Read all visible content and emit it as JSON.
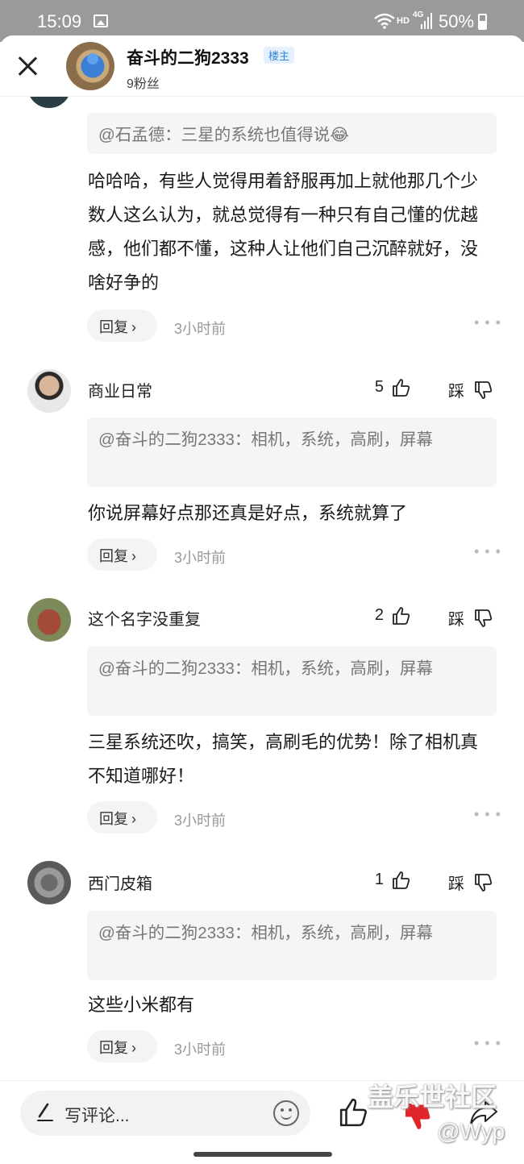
{
  "status_bar": {
    "time": "15:09",
    "network_hd": "HD",
    "network_type": "4G",
    "battery": "50%"
  },
  "header": {
    "author_name": "奋斗的二狗2333",
    "author_badge": "楼主",
    "fans": "9粉丝"
  },
  "comments": [
    {
      "quote": "@石孟德：三星的系统也值得说😂",
      "body": "哈哈哈，有些人觉得用着舒服再加上就他那几个少数人这么认为，就总觉得有一种只有自己懂的优越感，他们都不懂，这种人让他们自己沉醉就好，没啥好争的",
      "reply_label": "回复",
      "time": "3小时前"
    },
    {
      "name": "商业日常",
      "likes": "5",
      "dislike_label": "踩",
      "quote": "@奋斗的二狗2333：相机，系统，高刷，屏幕",
      "body": "你说屏幕好点那还真是好点，系统就算了",
      "reply_label": "回复",
      "time": "3小时前"
    },
    {
      "name": "这个名字没重复",
      "likes": "2",
      "dislike_label": "踩",
      "quote": "@奋斗的二狗2333：相机，系统，高刷，屏幕",
      "body": "三星系统还吹，搞笑，高刷毛的优势！除了相机真不知道哪好！",
      "reply_label": "回复",
      "time": "3小时前"
    },
    {
      "name": "西门皮箱",
      "likes": "1",
      "dislike_label": "踩",
      "quote": "@奋斗的二狗2333：相机，系统，高刷，屏幕",
      "body": "这些小米都有",
      "reply_label": "回复",
      "time": "3小时前"
    }
  ],
  "bottom_bar": {
    "input_placeholder": "写评论..."
  },
  "watermark": {
    "line1": "盖乐世社区",
    "line2": "@Wyp"
  },
  "colors": {
    "badge_text": "#2f83d9",
    "badge_bg": "#e5f0fc",
    "quote_bg": "#f5f5f5",
    "dislike_bottom": "#e0252b"
  }
}
